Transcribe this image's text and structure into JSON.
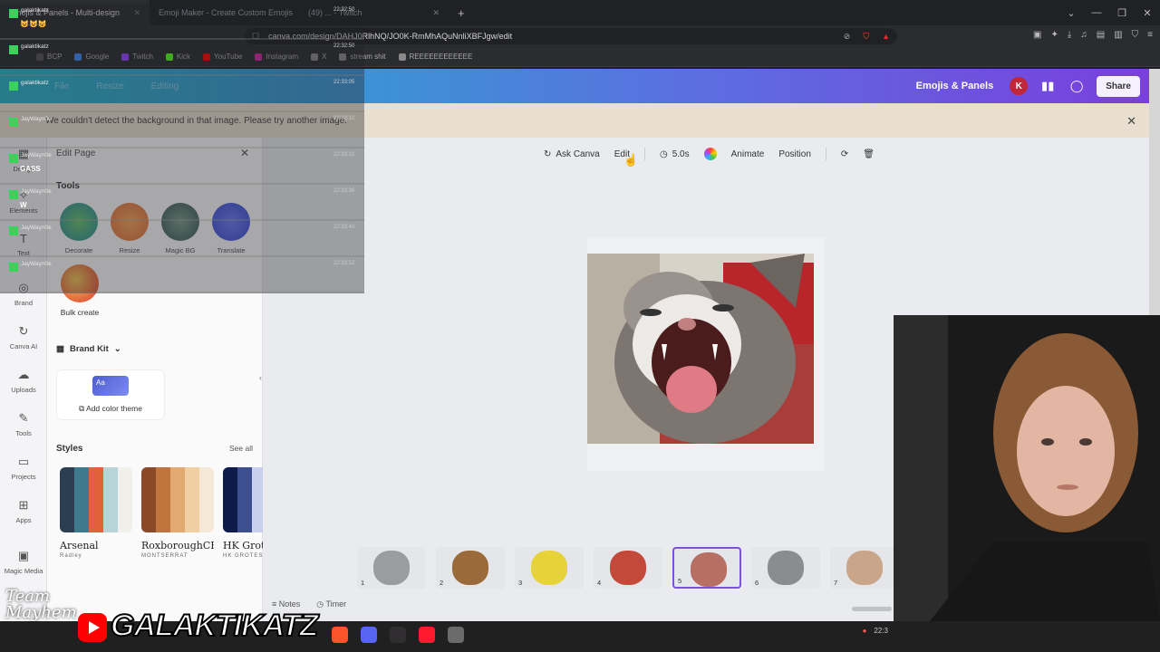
{
  "browser": {
    "tabs": [
      {
        "label": "Emojis & Panels - Multi-design",
        "active": true
      },
      {
        "label": "Emoji Maker - Create Custom Emojis",
        "active": false
      },
      {
        "label": "(49) ... - Twitch",
        "active": false
      }
    ],
    "new_tab": "+",
    "url": "canva.com/design/DAHJ0RlhNQ/JO0K-RmMhAQuNnliXBFJgw/edit",
    "window_controls": [
      "⌄",
      "—",
      "❐",
      "✕"
    ],
    "bookmarks": [
      {
        "label": "BCP",
        "color": "#555555"
      },
      {
        "label": "Google",
        "color": "#4285f4"
      },
      {
        "label": "Twitch",
        "color": "#9146ff"
      },
      {
        "label": "Kick",
        "color": "#53fc18"
      },
      {
        "label": "YouTube",
        "color": "#ff0000"
      },
      {
        "label": "Instagram",
        "color": "#d6249f"
      },
      {
        "label": "X",
        "color": "#888888"
      },
      {
        "label": "stream shit",
        "color": "#888888"
      },
      {
        "label": "REEEEEEEEEEEE",
        "color": "#888888"
      }
    ]
  },
  "header": {
    "nav": [
      "File",
      "Resize",
      "Editing"
    ],
    "design_title": "Emojis & Panels",
    "avatar_letter": "K",
    "share_label": "Share"
  },
  "notice": {
    "text": "We couldn't detect the background in that image. Please try another image.",
    "close": "✕"
  },
  "rail": {
    "items": [
      "Design",
      "Elements",
      "Text",
      "Brand",
      "Canva AI",
      "Uploads",
      "Tools",
      "Projects",
      "Apps",
      "Magic Media"
    ]
  },
  "panel": {
    "title": "Edit Page",
    "close": "✕",
    "tools_heading": "Tools",
    "tools": [
      "Decorate",
      "Resize",
      "Magic BG",
      "Translate"
    ],
    "bulk_create": "Bulk create",
    "brand_kit": "Brand Kit",
    "add_color_theme": "Add color theme",
    "swatch_text": "Aa",
    "styles_heading": "Styles",
    "see_all": "See all",
    "styles": [
      {
        "name": "Arsenal",
        "sub": "Radley",
        "colors": [
          "#2b3e52",
          "#3e7a8c",
          "#e0613a",
          "#b8d4d6",
          "#f1efe9"
        ]
      },
      {
        "name": "RoxboroughCF",
        "sub": "MONTSERRAT",
        "colors": [
          "#8a4a2a",
          "#c0743e",
          "#e2a971",
          "#f0d0a2",
          "#f6e8d6"
        ]
      },
      {
        "name": "HK Grotesk",
        "sub": "HK GROTESK",
        "colors": [
          "#0e1a4a",
          "#3d4f8f",
          "#c8d0ee",
          "#ffffff",
          "#ffffff"
        ]
      }
    ]
  },
  "context_toolbar": {
    "ask_canva": "Ask Canva",
    "edit": "Edit",
    "duration": "5.0s",
    "animate": "Animate",
    "position": "Position"
  },
  "pages": [
    {
      "num": "1",
      "color": "#9a9d9f"
    },
    {
      "num": "2",
      "color": "#9a6a3a"
    },
    {
      "num": "3",
      "color": "#e8d23a"
    },
    {
      "num": "4",
      "color": "#c34a3a"
    },
    {
      "num": "5",
      "color": "#b86f63",
      "active": true
    },
    {
      "num": "6",
      "color": "#8a8d8f"
    },
    {
      "num": "7",
      "color": "#c9a58a"
    }
  ],
  "bottom_bar": {
    "notes": "Notes",
    "timer": "Timer"
  },
  "chat": [
    {
      "user": "galaktikatz",
      "msg": "😺😺😺",
      "time": "22:32:50"
    },
    {
      "user": "galaktikatz",
      "msg": "",
      "time": "22:32:50"
    },
    {
      "user": "galaktikatz",
      "msg": "",
      "time": "22:33:05"
    },
    {
      "user": "JayWayn0e",
      "msg": "",
      "time": "22:33:10"
    },
    {
      "user": "JayWayn0e",
      "msg": "GASS",
      "time": "22:33:21"
    },
    {
      "user": "JayWayn0e",
      "msg": "W",
      "time": "22:33:36"
    },
    {
      "user": "JayWayn0e",
      "msg": "",
      "time": "22:33:40"
    },
    {
      "user": "JayWayn0e",
      "msg": "",
      "time": "22:33:52"
    }
  ],
  "branding": {
    "team_line1": "Team",
    "team_line2": "Mayhem",
    "channel": "GALAKTIKATZ"
  },
  "taskbar": {
    "icons": [
      {
        "name": "brave",
        "color": "#fb542b"
      },
      {
        "name": "discord",
        "color": "#5865f2"
      },
      {
        "name": "obs",
        "color": "#302e31"
      },
      {
        "name": "opera",
        "color": "#ff1b2d"
      },
      {
        "name": "settings",
        "color": "#6b6b6b"
      }
    ],
    "tray_text": "22:3"
  }
}
